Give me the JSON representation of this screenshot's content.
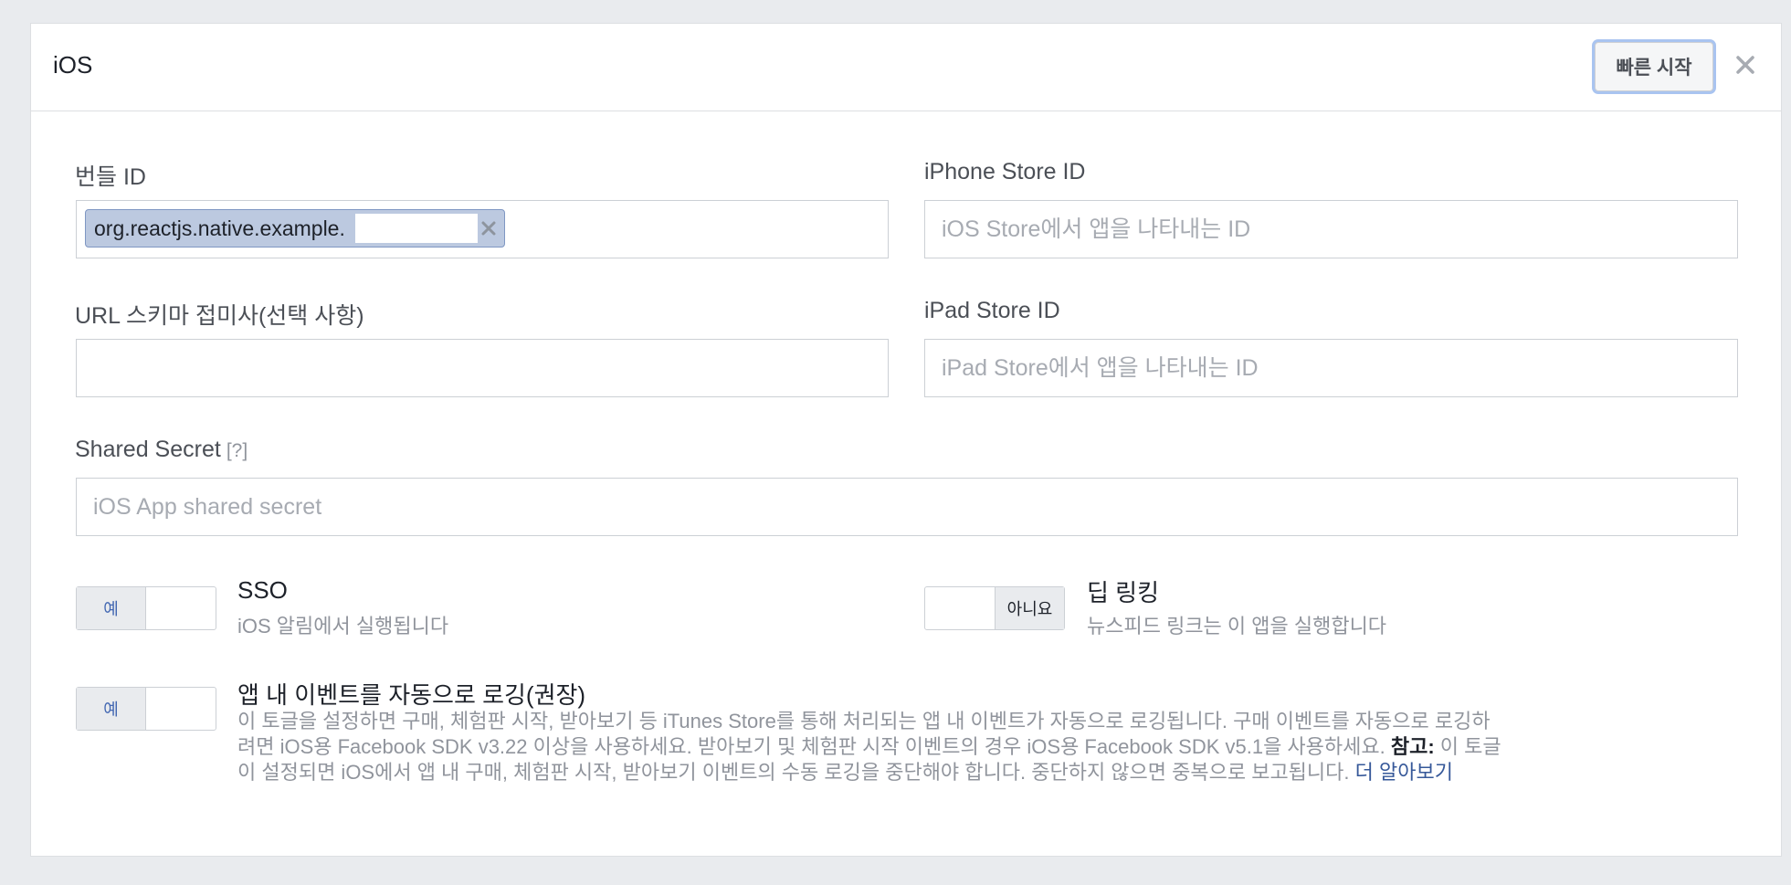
{
  "panel": {
    "title": "iOS",
    "quickstart_label": "빠른 시작",
    "close_icon": "close-icon"
  },
  "fields": {
    "bundle_id": {
      "label": "번들 ID",
      "token_value": "org.reactjs.native.example."
    },
    "iphone_store_id": {
      "label": "iPhone Store ID",
      "placeholder": "iOS Store에서 앱을 나타내는 ID",
      "value": ""
    },
    "url_scheme_suffix": {
      "label": "URL 스키마 접미사(선택 사항)",
      "placeholder": "",
      "value": ""
    },
    "ipad_store_id": {
      "label": "iPad Store ID",
      "placeholder": "iPad Store에서 앱을 나타내는 ID",
      "value": ""
    },
    "shared_secret": {
      "label": "Shared Secret",
      "help": "[?]",
      "placeholder": "iOS App shared secret",
      "value": ""
    }
  },
  "toggles": {
    "sso": {
      "state_label": "예",
      "title": "SSO",
      "subtitle": "iOS 알림에서 실행됩니다",
      "enabled": true
    },
    "deep_linking": {
      "state_label": "아니요",
      "title": "딥 링킹",
      "subtitle": "뉴스피드 링크는 이 앱을 실행합니다",
      "enabled": false
    },
    "auto_log_events": {
      "state_label": "예",
      "title": "앱 내 이벤트를 자동으로 로깅(권장)",
      "enabled": true,
      "desc_part1": "이 토글을 설정하면 구매, 체험판 시작, 받아보기 등 iTunes Store를 통해 처리되는 앱 내 이벤트가 자동으로 로깅됩니다. 구매 이벤트를 자동으로 로깅하려면 iOS용 Facebook SDK v3.22 이상을 사용하세요. 받아보기 및 체험판 시작 이벤트의 경우 iOS용 Facebook SDK v5.1을 사용하세요. ",
      "desc_note_label": "참고:",
      "desc_part2": " 이 토글이 설정되면 iOS에서 앱 내 구매, 체험판 시작, 받아보기 이벤트의 수동 로깅을 중단해야 합니다. 중단하지 않으면 중복으로 보고됩니다. ",
      "learn_more": "더 알아보기"
    }
  },
  "colors": {
    "link": "#365899",
    "toggle_yes_text": "#4267b2",
    "focus_ring": "#a9c4f0"
  }
}
